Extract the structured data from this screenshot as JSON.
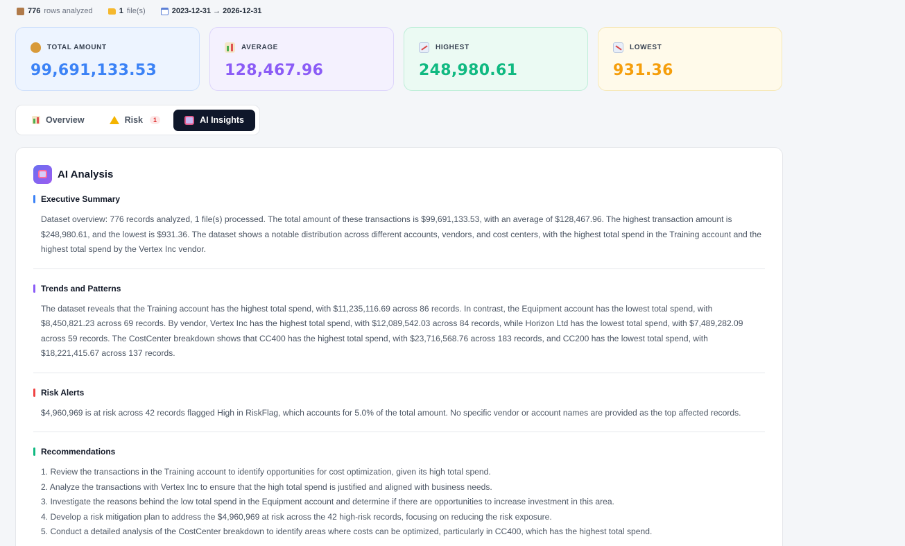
{
  "meta": {
    "rows_count": "776",
    "rows_label": "rows analyzed",
    "files_count": "1",
    "files_label": "file(s)",
    "date_range": "2023-12-31 → 2026-12-31"
  },
  "stats": [
    {
      "label": "TOTAL AMOUNT",
      "value": "99,691,133.53",
      "color": "#3b82f6",
      "icon": "money-bag-icon"
    },
    {
      "label": "AVERAGE",
      "value": "128,467.96",
      "color": "#8b5cf6",
      "icon": "bar-chart-icon"
    },
    {
      "label": "HIGHEST",
      "value": "248,980.61",
      "color": "#10b981",
      "icon": "trend-up-icon"
    },
    {
      "label": "LOWEST",
      "value": "931.36",
      "color": "#f59e0b",
      "icon": "trend-down-icon"
    }
  ],
  "tabs": {
    "overview": "Overview",
    "risk": "Risk",
    "risk_badge": "1",
    "ai_insights": "AI Insights"
  },
  "panel": {
    "title": "AI Analysis",
    "sections": [
      {
        "title": "Executive Summary",
        "color": "#3b82f6",
        "body": "Dataset overview: 776 records analyzed, 1 file(s) processed. The total amount of these transactions is $99,691,133.53, with an average of $128,467.96. The highest transaction amount is $248,980.61, and the lowest is $931.36. The dataset shows a notable distribution across different accounts, vendors, and cost centers, with the highest total spend in the Training account and the highest total spend by the Vertex Inc vendor."
      },
      {
        "title": "Trends and Patterns",
        "color": "#8b5cf6",
        "body": "The dataset reveals that the Training account has the highest total spend, with $11,235,116.69 across 86 records. In contrast, the Equipment account has the lowest total spend, with $8,450,821.23 across 69 records. By vendor, Vertex Inc has the highest total spend, with $12,089,542.03 across 84 records, while Horizon Ltd has the lowest total spend, with $7,489,282.09 across 59 records. The CostCenter breakdown shows that CC400 has the highest total spend, with $23,716,568.76 across 183 records, and CC200 has the lowest total spend, with $18,221,415.67 across 137 records."
      },
      {
        "title": "Risk Alerts",
        "color": "#ef4444",
        "body": "$4,960,969 is at risk across 42 records flagged High in RiskFlag, which accounts for 5.0% of the total amount. No specific vendor or account names are provided as the top affected records."
      },
      {
        "title": "Recommendations",
        "color": "#10b981",
        "items": [
          "1. Review the transactions in the Training account to identify opportunities for cost optimization, given its high total spend.",
          "2. Analyze the transactions with Vertex Inc to ensure that the high total spend is justified and aligned with business needs.",
          "3. Investigate the reasons behind the low total spend in the Equipment account and determine if there are opportunities to increase investment in this area.",
          "4. Develop a risk mitigation plan to address the $4,960,969 at risk across the 42 high-risk records, focusing on reducing the risk exposure.",
          "5. Conduct a detailed analysis of the CostCenter breakdown to identify areas where costs can be optimized, particularly in CC400, which has the highest total spend."
        ]
      }
    ]
  }
}
